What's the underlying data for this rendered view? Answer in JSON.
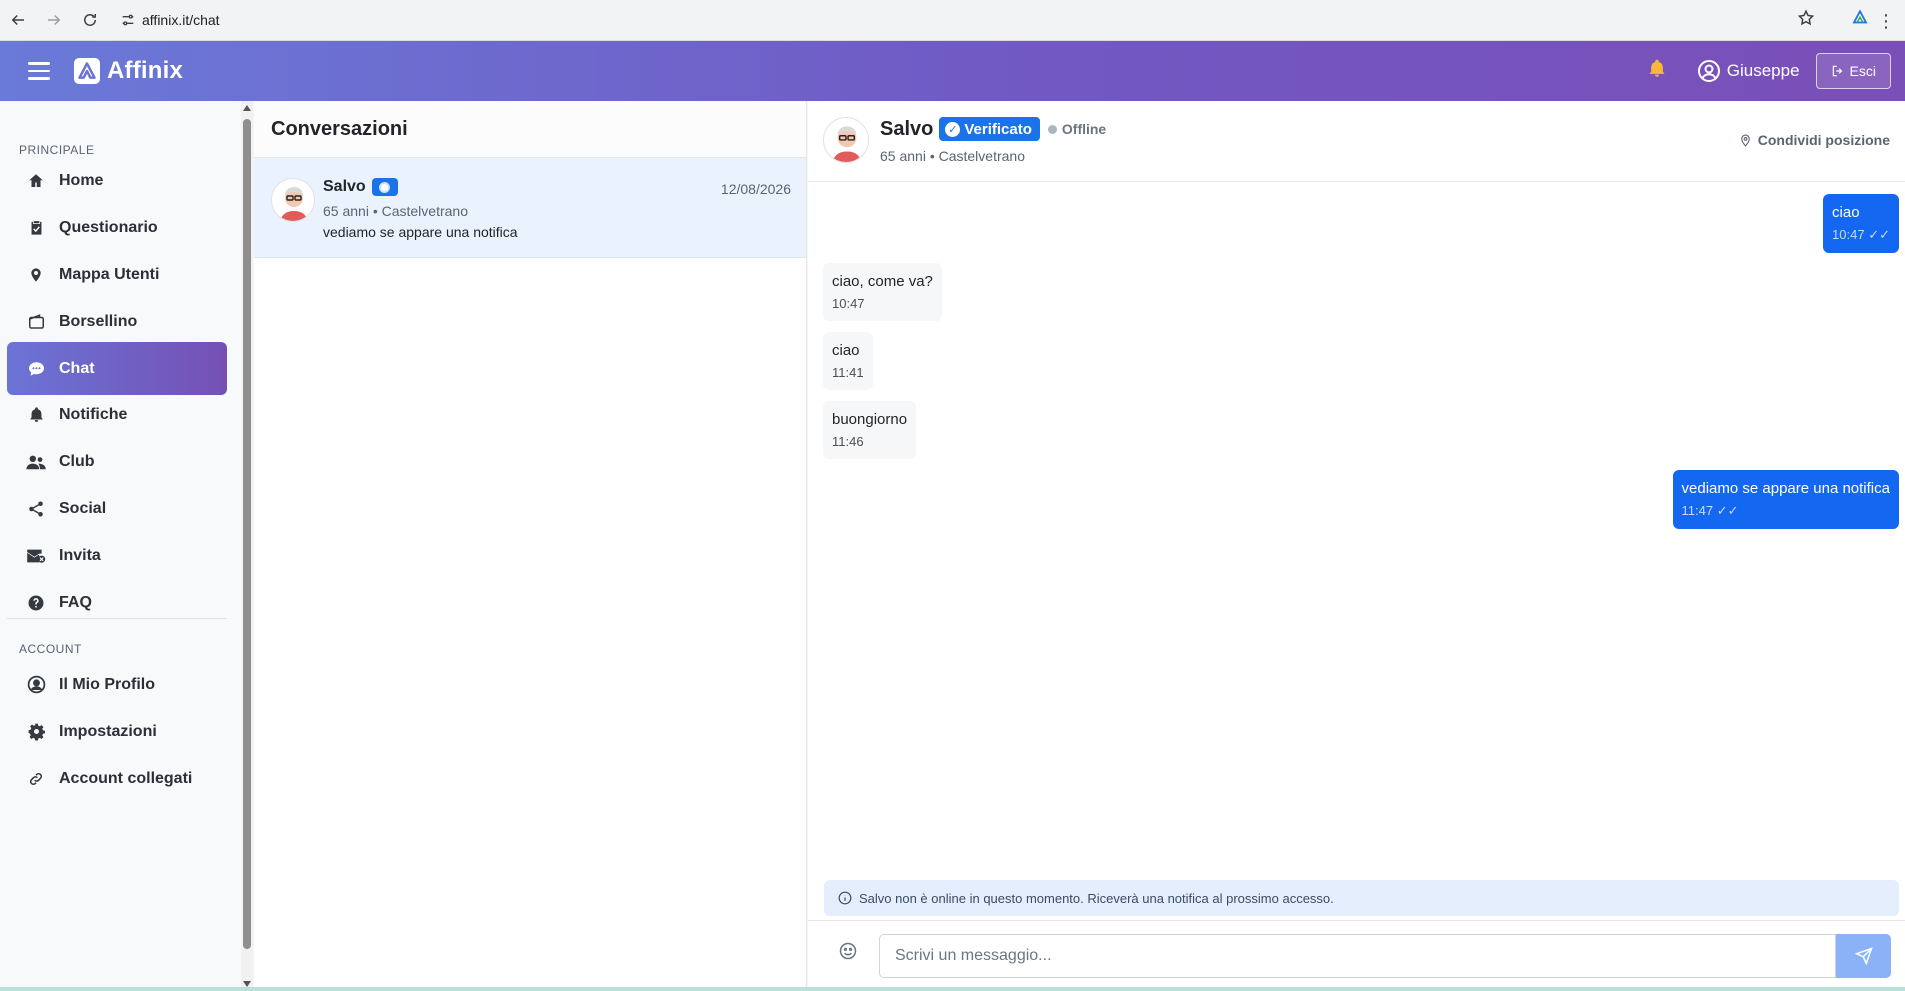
{
  "browser": {
    "url": "affinix.it/chat"
  },
  "header": {
    "brand": "Affinix",
    "user_name": "Giuseppe",
    "logout_label": "Esci"
  },
  "sidebar": {
    "section_main": "PRINCIPALE",
    "items": [
      {
        "label": "Home",
        "icon": "home-icon"
      },
      {
        "label": "Questionario",
        "icon": "clipboard-icon"
      },
      {
        "label": "Mappa Utenti",
        "icon": "map-pin-icon"
      },
      {
        "label": "Borsellino",
        "icon": "wallet-icon"
      },
      {
        "label": "Chat",
        "icon": "chat-icon",
        "active": true
      },
      {
        "label": "Notifiche",
        "icon": "bell-icon"
      },
      {
        "label": "Club",
        "icon": "people-icon"
      },
      {
        "label": "Social",
        "icon": "share-icon"
      },
      {
        "label": "Invita",
        "icon": "mail-icon"
      },
      {
        "label": "FAQ",
        "icon": "question-icon"
      }
    ],
    "section_account": "ACCOUNT",
    "account_items": [
      {
        "label": "Il Mio Profilo",
        "icon": "user-circle-icon"
      },
      {
        "label": "Impostazioni",
        "icon": "gear-icon"
      },
      {
        "label": "Account collegati",
        "icon": "link-icon"
      }
    ]
  },
  "conversations": {
    "title": "Conversazioni",
    "items": [
      {
        "name": "Salvo",
        "subtitle": "65 anni • Castelvetrano",
        "preview": "vediamo se appare una notifica",
        "date": "12/08/2026"
      }
    ]
  },
  "chat": {
    "name": "Salvo",
    "verified_label": "Verificato",
    "status": "Offline",
    "subtitle": "65 anni • Castelvetrano",
    "share_label": "Condividi posizione",
    "messages": [
      {
        "direction": "out",
        "text": "ciao",
        "time": "10:47"
      },
      {
        "direction": "in",
        "text": "ciao, come va?",
        "time": "10:47"
      },
      {
        "direction": "in",
        "text": "ciao",
        "time": "11:41"
      },
      {
        "direction": "in",
        "text": "buongiorno",
        "time": "11:46"
      },
      {
        "direction": "out",
        "text": "vediamo se appare una notifica",
        "time": "11:47"
      }
    ],
    "offline_notice": "Salvo non è online in questo momento. Riceverà una notifica al prossimo accesso.",
    "input_placeholder": "Scrivi un messaggio..."
  },
  "colors": {
    "accent": "#7158c3",
    "primary_blue": "#1467f0",
    "active_item": "#6b74d6"
  }
}
